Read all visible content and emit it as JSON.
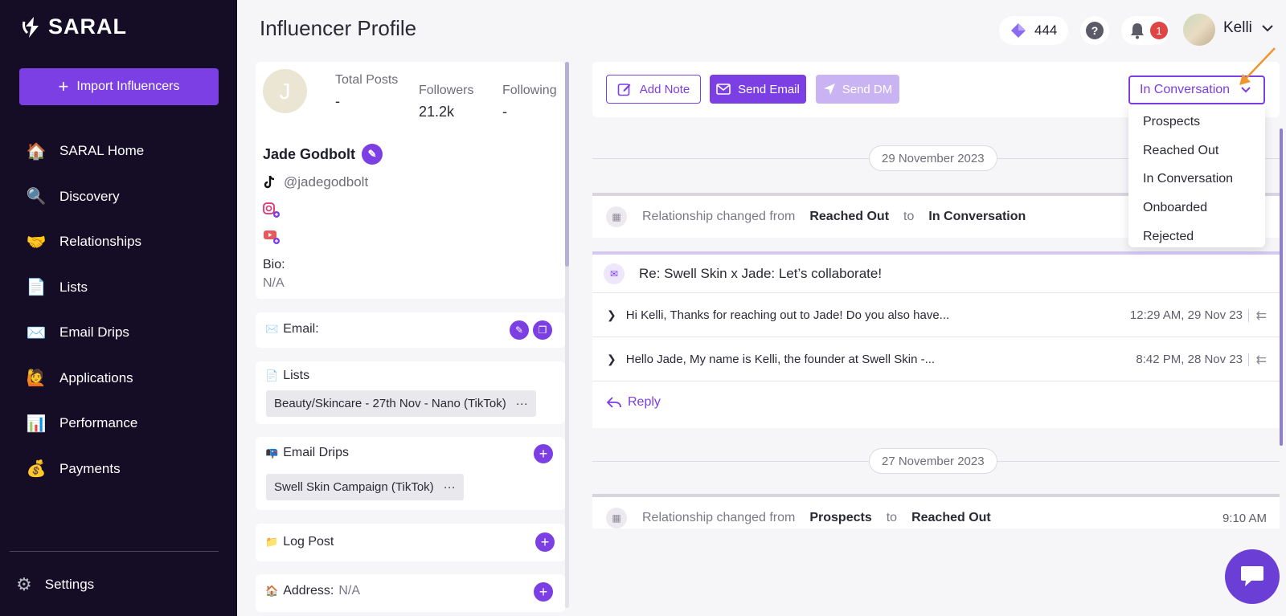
{
  "app": {
    "name": "SARAL"
  },
  "sidebar": {
    "import_label": "Import Influencers",
    "items": [
      {
        "label": "SARAL Home",
        "icon": "🏠"
      },
      {
        "label": "Discovery",
        "icon": "🔍"
      },
      {
        "label": "Relationships",
        "icon": "🤝"
      },
      {
        "label": "Lists",
        "icon": "📄"
      },
      {
        "label": "Email Drips",
        "icon": "✉️"
      },
      {
        "label": "Applications",
        "icon": "🙋"
      },
      {
        "label": "Performance",
        "icon": "📊"
      },
      {
        "label": "Payments",
        "icon": "💰"
      }
    ],
    "settings_label": "Settings"
  },
  "header": {
    "title": "Influencer Profile",
    "credits": "444",
    "help": "?",
    "notifications": "1",
    "user_name": "Kelli"
  },
  "profile": {
    "initial": "J",
    "stats": {
      "total_posts_label": "Total Posts",
      "total_posts": "-",
      "followers_label": "Followers",
      "followers": "21.2k",
      "following_label": "Following",
      "following": "-"
    },
    "name": "Jade Godbolt",
    "handle": "@jadegodbolt",
    "bio_label": "Bio:",
    "bio": "N/A"
  },
  "email_section": {
    "label": "Email:",
    "icon": "✉️"
  },
  "lists_section": {
    "label": "Lists",
    "icon": "📄",
    "item": "Beauty/Skincare - 27th Nov - Nano (TikTok)"
  },
  "drips_section": {
    "label": "Email Drips",
    "icon": "📭",
    "item": "Swell Skin Campaign (TikTok)"
  },
  "log_post": {
    "label": "Log Post",
    "icon": "📁"
  },
  "address": {
    "label": "Address:",
    "icon": "🏠",
    "value": "N/A"
  },
  "actions": {
    "add_note": "Add Note",
    "send_email": "Send Email",
    "send_dm": "Send DM"
  },
  "status": {
    "current": "In Conversation",
    "options": [
      "Prospects",
      "Reached Out",
      "In Conversation",
      "Onboarded",
      "Rejected"
    ]
  },
  "timeline": {
    "date1": "29 November 2023",
    "event1": {
      "prefix": "Relationship changed from",
      "from": "Reached Out",
      "to_word": "to",
      "to": "In Conversation"
    },
    "email": {
      "subject": "Re: Swell Skin x Jade: Let’s collaborate!",
      "threads": [
        {
          "preview": "Hi Kelli, Thanks for reaching out to Jade! Do you also have...",
          "time": "12:29 AM, 29 Nov 23"
        },
        {
          "preview": "Hello Jade, My name is Kelli, the founder at Swell Skin -...",
          "time": "8:42 PM, 28 Nov 23"
        }
      ],
      "reply_label": "Reply"
    },
    "date2": "27 November 2023",
    "event2": {
      "prefix": "Relationship changed from",
      "from": "Prospects",
      "to_word": "to",
      "to": "Reached Out",
      "time": "9:10 AM"
    }
  },
  "colors": {
    "accent": "#7b3fe4",
    "sidebar": "#150c26",
    "badge": "#e04545",
    "arrow": "#f0962e"
  }
}
